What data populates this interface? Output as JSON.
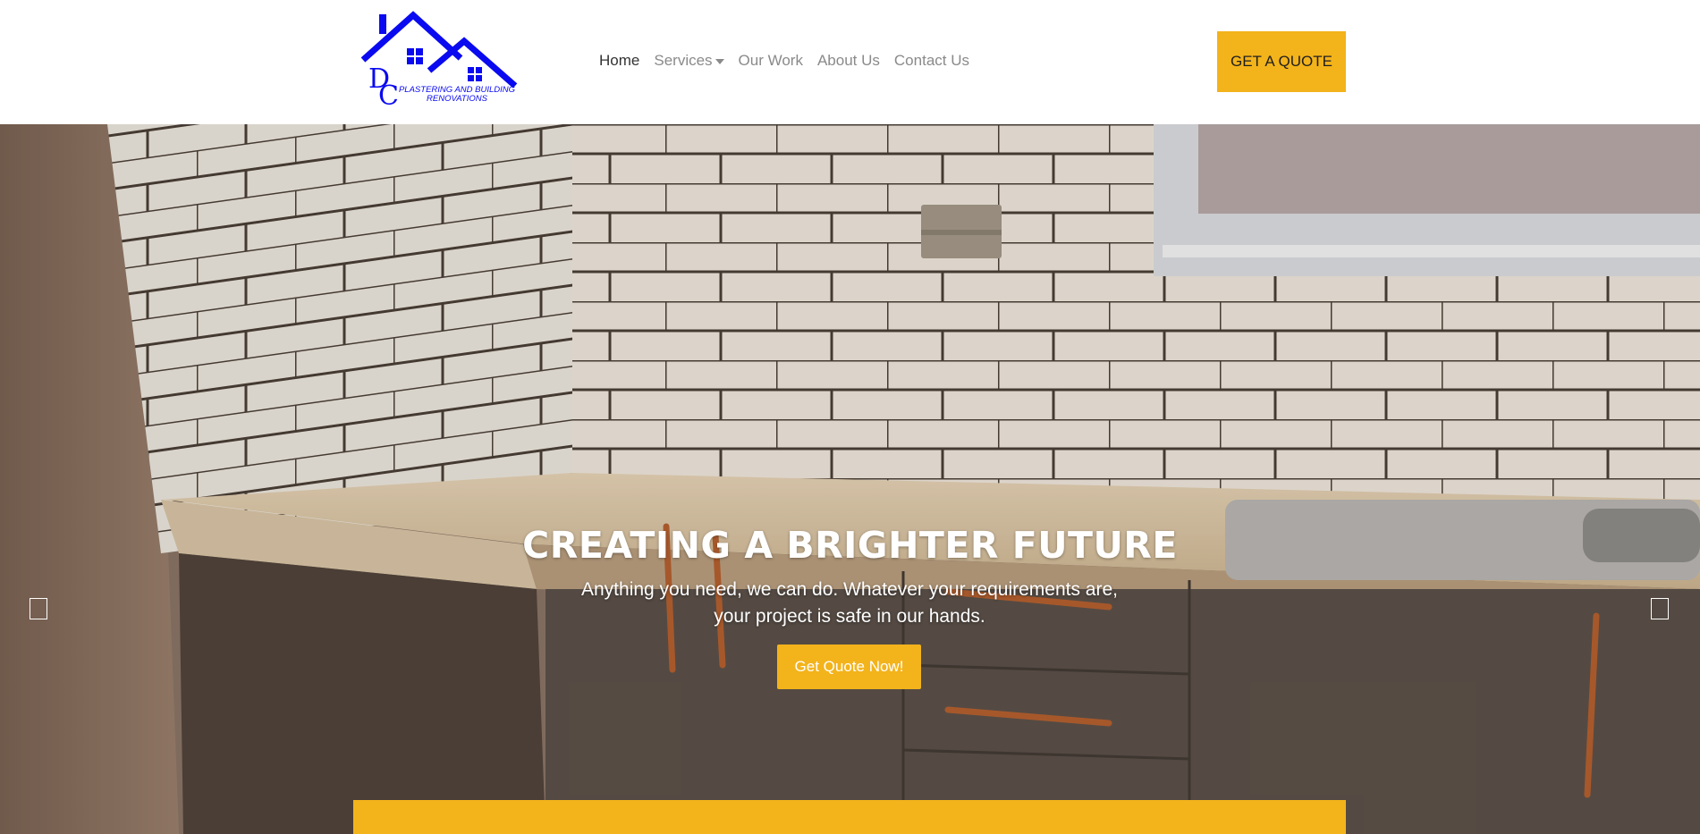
{
  "header": {
    "logo": {
      "line1": "PLASTERING AND BUILDING",
      "line2": "RENOVATIONS",
      "monogram_d": "D",
      "monogram_c": "C",
      "color": "#0a0af0"
    },
    "nav": {
      "home": "Home",
      "services": "Services",
      "our_work": "Our Work",
      "about_us": "About Us",
      "contact_us": "Contact Us"
    },
    "quote_button": "GET A QUOTE"
  },
  "hero": {
    "title": "CREATING A BRIGHTER FUTURE",
    "subtitle": "Anything you need, we can do. Whatever your requirements are, your project is safe in our hands.",
    "cta": "Get Quote Now!",
    "slides": 2,
    "active_slide": 1,
    "prev_icon": "chevron-left-icon",
    "next_icon": "chevron-right-icon"
  },
  "colors": {
    "accent": "#f3b31b",
    "logo_blue": "#0a0af0",
    "nav_text": "#8a8a8a",
    "nav_active": "#333333"
  }
}
